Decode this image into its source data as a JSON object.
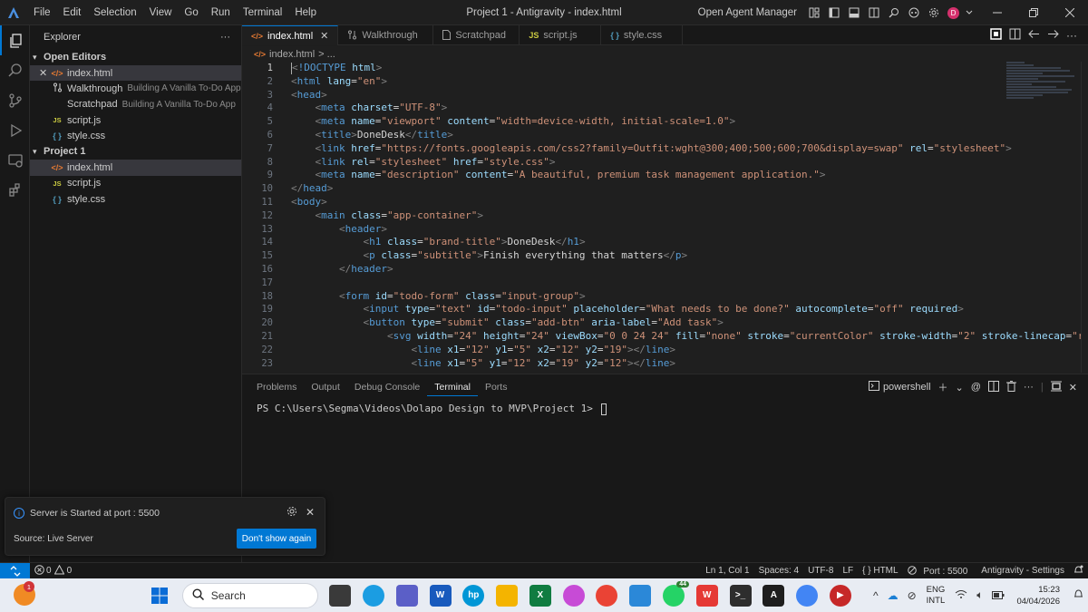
{
  "titlebar": {
    "menu": [
      "File",
      "Edit",
      "Selection",
      "View",
      "Go",
      "Run",
      "Terminal",
      "Help"
    ],
    "window_title": "Project 1 - Antigravity - index.html",
    "open_agent_manager": "Open Agent Manager",
    "avatar_letter": "D"
  },
  "explorer": {
    "title": "Explorer",
    "more": "···",
    "open_editors": {
      "title": "Open Editors",
      "items": [
        {
          "name": "index.html",
          "icon": "</>",
          "desc": ""
        },
        {
          "name": "Walkthrough",
          "icon": "walkthrough-icon",
          "desc": "Building A Vanilla To-Do App"
        },
        {
          "name": "Scratchpad",
          "icon": "",
          "desc": "Building A Vanilla To-Do App"
        },
        {
          "name": "script.js",
          "icon": "JS",
          "desc": ""
        },
        {
          "name": "style.css",
          "icon": "{ }",
          "desc": ""
        }
      ]
    },
    "project": {
      "title": "Project 1",
      "items": [
        {
          "name": "index.html",
          "icon": "</>"
        },
        {
          "name": "script.js",
          "icon": "JS"
        },
        {
          "name": "style.css",
          "icon": "{ }"
        }
      ]
    }
  },
  "tabs": [
    {
      "label": "index.html",
      "icon": "</>"
    },
    {
      "label": "Walkthrough",
      "icon": "walkthrough-icon"
    },
    {
      "label": "Scratchpad",
      "icon": "file-icon"
    },
    {
      "label": "script.js",
      "icon": "JS"
    },
    {
      "label": "style.css",
      "icon": "{ }"
    }
  ],
  "breadcrumb": {
    "file": "index.html",
    "rest": "> ..."
  },
  "editor": {
    "line_numbers": [
      "1",
      "2",
      "3",
      "4",
      "5",
      "6",
      "7",
      "8",
      "9",
      "10",
      "11",
      "12",
      "13",
      "14",
      "15",
      "16",
      "17",
      "18",
      "19",
      "20",
      "21",
      "22",
      "23"
    ]
  },
  "panel": {
    "tabs": [
      "Problems",
      "Output",
      "Debug Console",
      "Terminal",
      "Ports"
    ],
    "shell": "powershell",
    "prompt": "PS C:\\Users\\Segma\\Videos\\Dolapo Design to MVP\\Project 1> "
  },
  "notification": {
    "message": "Server is Started at port : 5500",
    "source": "Source: Live Server",
    "button": "Don't show again"
  },
  "statusbar": {
    "errors": "0",
    "warnings": "0",
    "position": "Ln 1, Col 1",
    "spaces": "Spaces: 4",
    "encoding": "UTF-8",
    "eol": "LF",
    "language": "{ } HTML",
    "port": "Port : 5500",
    "settings": "Antigravity - Settings"
  },
  "taskbar": {
    "weather_badge": "1",
    "search": "Search",
    "whatsapp_badge": "44",
    "lang_top": "ENG",
    "lang_bottom": "INTL",
    "time": "15:23",
    "date": "04/04/2026"
  }
}
